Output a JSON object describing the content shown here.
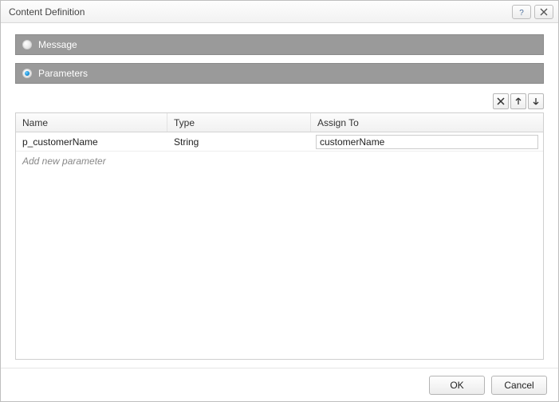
{
  "window": {
    "title": "Content Definition"
  },
  "options": {
    "message": {
      "label": "Message",
      "selected": false
    },
    "parameters": {
      "label": "Parameters",
      "selected": true
    }
  },
  "toolbar": {
    "delete_tooltip": "Delete",
    "move_up_tooltip": "Move Up",
    "move_down_tooltip": "Move Down"
  },
  "grid": {
    "headers": {
      "name": "Name",
      "type": "Type",
      "assign": "Assign To"
    },
    "rows": [
      {
        "name": "p_customerName",
        "type": "String",
        "assign": "customerName"
      }
    ],
    "add_placeholder": "Add new parameter"
  },
  "footer": {
    "ok": "OK",
    "cancel": "Cancel"
  }
}
